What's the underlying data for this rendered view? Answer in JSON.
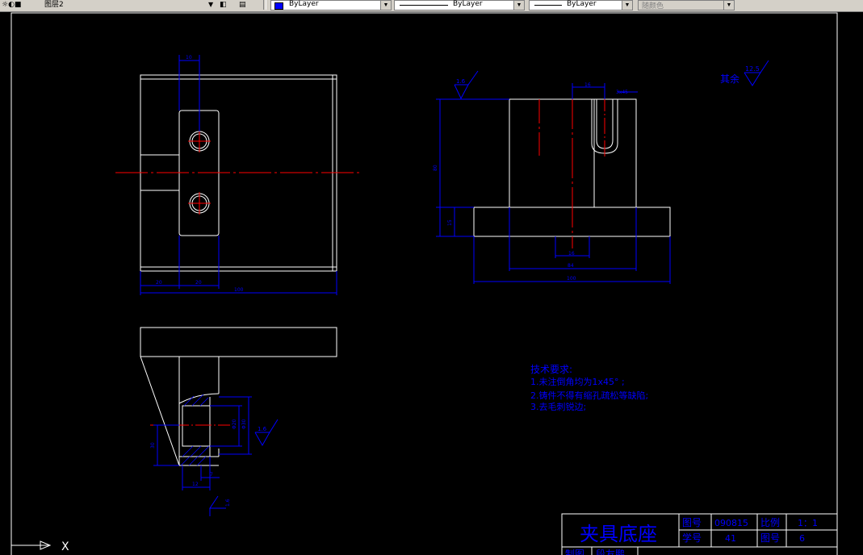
{
  "toolbar": {
    "layer_name": "图层2",
    "color_control": "ByLayer",
    "linetype_control": "ByLayer",
    "lineweight_control": "ByLayer",
    "plotstyle_control": "随颜色"
  },
  "drawing": {
    "dims_top_view": {
      "d1": "10",
      "d2": "20",
      "d3": "20",
      "d4": "100"
    },
    "dims_front_view": {
      "d1": "16",
      "d2": "3x45",
      "d3": "10",
      "d4": "16",
      "d5": "84",
      "d6": "100",
      "d7": "80",
      "d8": "15"
    },
    "dims_section": {
      "d1": "Φ20",
      "d2": "Φ30",
      "d3": "30",
      "d4": "16",
      "d5": "12",
      "d6": "7"
    },
    "roughness": {
      "front": "1.6",
      "section": "1.6",
      "section_small": "1.6",
      "rest_label": "其余",
      "rest_value": "12.5"
    },
    "tech_requirements": {
      "title": "技术要求:",
      "line1": "1.未注倒角均为1x45° ;",
      "line2": "2.铸件不得有缩孔疏松等缺陷;",
      "line3": "3.去毛刺锐边;"
    },
    "title_block": {
      "part_name": "夹具底座",
      "label_drawing_no": "图号",
      "drawing_no": "090815",
      "label_scale": "比例",
      "scale": "1：1",
      "label_seq": "学号",
      "seq": "41",
      "label_sheet": "图号",
      "sheet": "6",
      "label_drafter": "制图",
      "drafter": "段友鹏"
    },
    "ucs_label": "X"
  },
  "colors": {
    "background": "#000000",
    "outline": "#ffffff",
    "dimension": "#0000ff",
    "centerline": "#ff0000"
  }
}
